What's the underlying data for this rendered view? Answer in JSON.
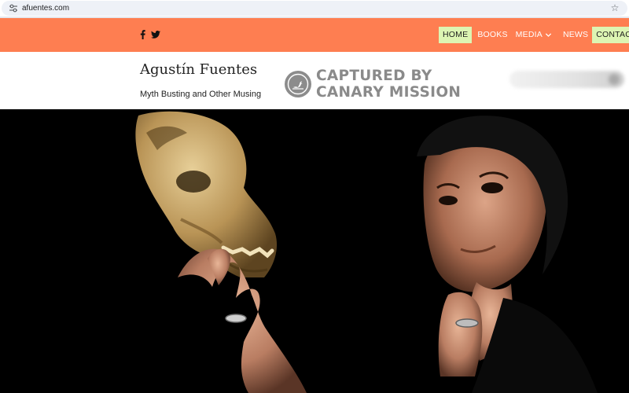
{
  "browser": {
    "url": "afuentes.com",
    "icons": {
      "site_info": "tune-icon",
      "bookmark": "star-icon"
    }
  },
  "nav": {
    "background": "#fe7e51",
    "highlight": "#ddf5b3",
    "social": [
      {
        "icon": "facebook-icon"
      },
      {
        "icon": "twitter-icon"
      }
    ],
    "menu": {
      "home": "HOME",
      "books": "BOOKS",
      "media": "MEDIA",
      "news": "NEWS",
      "contact": "CONTACT"
    }
  },
  "header": {
    "title": "Agustín Fuentes",
    "tagline": "Myth Busting and Other Musing",
    "stamp_line1": "CAPTURED BY",
    "stamp_line2": "CANARY MISSION"
  },
  "hero": {
    "background": "#000000",
    "image": "photo-hand-holding-skull-and-man-thinking"
  }
}
